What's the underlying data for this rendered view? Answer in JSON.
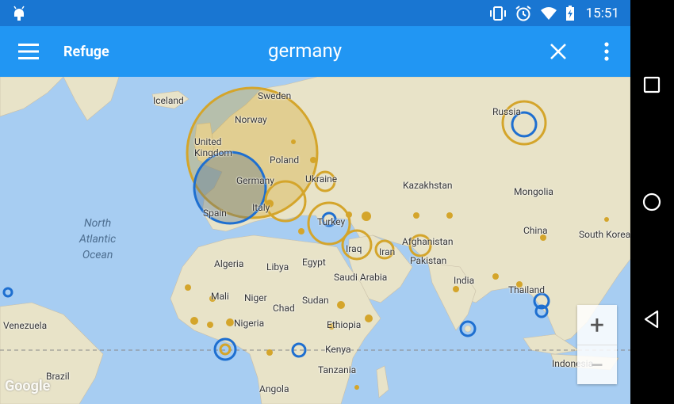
{
  "status_bar": {
    "time": "15:51",
    "icons": [
      "vibrate-icon",
      "alarm-icon",
      "wifi-icon",
      "battery-charging-icon"
    ]
  },
  "app_bar": {
    "title": "Refuge",
    "search_query": "germany"
  },
  "map": {
    "ocean_label": [
      "North",
      "Atlantic",
      "Ocean"
    ],
    "places": [
      {
        "id": "iceland",
        "label": "Iceland"
      },
      {
        "id": "sweden",
        "label": "Sweden"
      },
      {
        "id": "norway",
        "label": "Norway"
      },
      {
        "id": "united-kingdom",
        "label": "United\nKingdom"
      },
      {
        "id": "poland",
        "label": "Poland"
      },
      {
        "id": "germany",
        "label": "Germany"
      },
      {
        "id": "ukraine",
        "label": "Ukraine"
      },
      {
        "id": "italy",
        "label": "Italy"
      },
      {
        "id": "spain",
        "label": "Spain"
      },
      {
        "id": "russia",
        "label": "Russia"
      },
      {
        "id": "kazakhstan",
        "label": "Kazakhstan"
      },
      {
        "id": "mongolia",
        "label": "Mongolia"
      },
      {
        "id": "turkey",
        "label": "Turkey"
      },
      {
        "id": "afghanistan",
        "label": "Afghanistan"
      },
      {
        "id": "china",
        "label": "China"
      },
      {
        "id": "south-korea",
        "label": "South Korea"
      },
      {
        "id": "iraq",
        "label": "Iraq"
      },
      {
        "id": "iran",
        "label": "Iran"
      },
      {
        "id": "pakistan",
        "label": "Pakistan"
      },
      {
        "id": "algeria",
        "label": "Algeria"
      },
      {
        "id": "libya",
        "label": "Libya"
      },
      {
        "id": "egypt",
        "label": "Egypt"
      },
      {
        "id": "saudi-arabia",
        "label": "Saudi Arabia"
      },
      {
        "id": "india",
        "label": "India"
      },
      {
        "id": "thailand",
        "label": "Thailand"
      },
      {
        "id": "mali",
        "label": "Mali"
      },
      {
        "id": "niger",
        "label": "Niger"
      },
      {
        "id": "chad",
        "label": "Chad"
      },
      {
        "id": "sudan",
        "label": "Sudan"
      },
      {
        "id": "venezuela",
        "label": "Venezuela"
      },
      {
        "id": "nigeria",
        "label": "Nigeria"
      },
      {
        "id": "ethiopia",
        "label": "Ethiopia"
      },
      {
        "id": "kenya",
        "label": "Kenya"
      },
      {
        "id": "indonesia",
        "label": "Indonesia"
      },
      {
        "id": "tanzania",
        "label": "Tanzania"
      },
      {
        "id": "brazil",
        "label": "Brazil"
      },
      {
        "id": "angola",
        "label": "Angola"
      }
    ],
    "zoom_in_label": "+",
    "zoom_out_label": "−",
    "attribution": "Google",
    "colors": {
      "gold": "#D4A52B",
      "blue": "#1E6FD0",
      "water": "#a7cdf2",
      "land": "#e8e3c8"
    }
  },
  "nav_bar": {
    "buttons": [
      "recents-button",
      "home-button",
      "back-button"
    ]
  }
}
